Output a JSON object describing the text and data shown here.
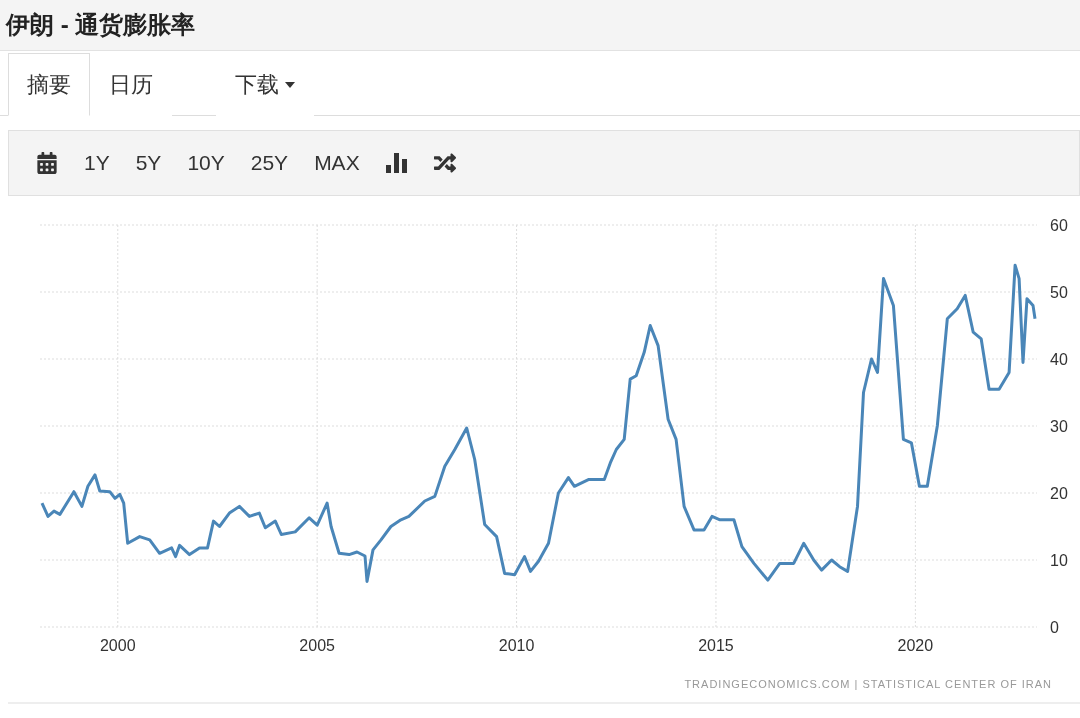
{
  "title": "伊朗 - 通货膨胀率",
  "tabs": [
    {
      "label": "摘要",
      "selected": true,
      "dropdown": false
    },
    {
      "label": "日历",
      "selected": false,
      "dropdown": false
    },
    {
      "label": "下载",
      "selected": false,
      "dropdown": true
    }
  ],
  "toolbar": {
    "ranges": [
      "1Y",
      "5Y",
      "10Y",
      "25Y",
      "MAX"
    ]
  },
  "chart": {
    "chart_data": {
      "type": "line",
      "grid": true,
      "xlim": [
        1998.05,
        2023.05
      ],
      "ylim": [
        0,
        60
      ],
      "xticks": [
        2000,
        2005,
        2010,
        2015,
        2020
      ],
      "yticks": [
        0,
        10,
        20,
        30,
        40,
        50,
        60
      ],
      "x": [
        1998.1,
        1998.25,
        1998.4,
        1998.55,
        1998.9,
        1999.1,
        1999.25,
        1999.43,
        1999.55,
        1999.8,
        1999.93,
        2000.05,
        2000.15,
        2000.25,
        2000.55,
        2000.8,
        2001.05,
        2001.35,
        2001.45,
        2001.55,
        2001.8,
        2002.05,
        2002.25,
        2002.4,
        2002.55,
        2002.8,
        2003.05,
        2003.3,
        2003.55,
        2003.7,
        2003.95,
        2004.1,
        2004.45,
        2004.8,
        2005.0,
        2005.25,
        2005.35,
        2005.55,
        2005.8,
        2006.0,
        2006.2,
        2006.25,
        2006.4,
        2006.6,
        2006.85,
        2007.1,
        2007.3,
        2007.7,
        2007.95,
        2008.2,
        2008.45,
        2008.75,
        2008.95,
        2009.2,
        2009.5,
        2009.7,
        2009.95,
        2010.2,
        2010.35,
        2010.55,
        2010.8,
        2011.05,
        2011.3,
        2011.45,
        2011.8,
        2012.2,
        2012.35,
        2012.5,
        2012.7,
        2012.85,
        2013.0,
        2013.2,
        2013.35,
        2013.55,
        2013.8,
        2014.0,
        2014.2,
        2014.45,
        2014.7,
        2014.9,
        2015.1,
        2015.45,
        2015.65,
        2015.95,
        2016.3,
        2016.6,
        2016.95,
        2017.2,
        2017.45,
        2017.65,
        2017.9,
        2018.1,
        2018.3,
        2018.55,
        2018.7,
        2018.9,
        2019.05,
        2019.2,
        2019.45,
        2019.7,
        2019.9,
        2020.1,
        2020.3,
        2020.55,
        2020.8,
        2021.05,
        2021.25,
        2021.45,
        2021.65,
        2021.85,
        2022.1,
        2022.35,
        2022.5,
        2022.6,
        2022.7,
        2022.8,
        2022.95,
        2023.0
      ],
      "series": [
        {
          "color": "#4a86b8",
          "values": [
            18.5,
            16.5,
            17.3,
            16.8,
            20.2,
            18.0,
            21,
            22.7,
            20.3,
            20.2,
            19.2,
            19.8,
            18.5,
            12.5,
            13.5,
            13,
            11,
            11.8,
            10.5,
            12.2,
            10.8,
            11.8,
            11.8,
            15.8,
            15,
            17,
            18,
            16.5,
            17,
            14.8,
            15.8,
            13.8,
            14.2,
            16.3,
            15.2,
            18.5,
            15,
            11,
            10.8,
            11.2,
            10.6,
            6.8,
            11.5,
            13,
            15,
            16,
            16.5,
            18.8,
            19.5,
            24,
            26.5,
            29.7,
            25,
            15.3,
            13.5,
            8,
            7.8,
            10.5,
            8.3,
            9.8,
            12.5,
            20,
            22.3,
            21,
            22,
            22,
            24.5,
            26.5,
            28,
            37,
            37.5,
            41,
            45,
            42,
            31,
            28,
            18,
            14.5,
            14.5,
            16.5,
            16,
            16,
            12,
            9.5,
            7,
            9.5,
            9.5,
            12.5,
            10,
            8.5,
            10,
            9,
            8.3,
            18,
            35,
            40,
            38,
            52,
            48,
            28,
            27.5,
            21,
            21,
            30,
            46,
            47.5,
            49.5,
            44,
            43,
            35.5,
            35.5,
            38,
            54,
            52,
            39.5,
            49,
            48,
            46
          ]
        }
      ]
    },
    "source": "TRADINGECONOMICS.COM | STATISTICAL CENTER OF IRAN"
  }
}
